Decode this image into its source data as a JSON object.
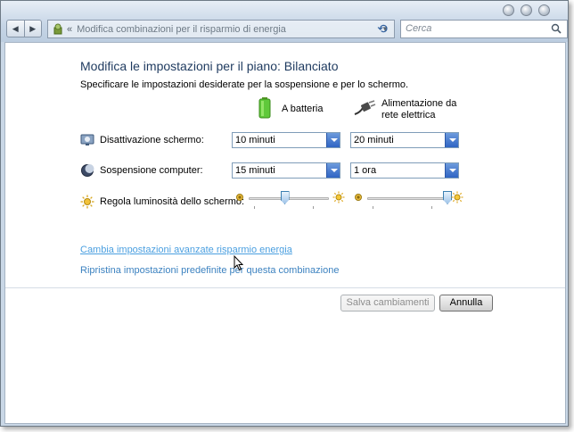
{
  "nav": {
    "back_glyph": "◀",
    "forward_glyph": "▶",
    "breadcrumb_sep": "«",
    "address_path": "Modifica combinazioni per il risparmio di energia",
    "search_placeholder": "Cerca"
  },
  "page": {
    "title": "Modifica le impostazioni per il piano: Bilanciato",
    "subtitle": "Specificare le impostazioni desiderate per la sospensione e per lo schermo.",
    "col_battery": "A batteria",
    "col_plugged_line1": "Alimentazione da",
    "col_plugged_line2": "rete elettrica"
  },
  "rows": {
    "display_off": {
      "label": "Disattivazione schermo:",
      "battery_value": "10 minuti",
      "plugged_value": "20 minuti"
    },
    "sleep": {
      "label": "Sospensione computer:",
      "battery_value": "15 minuti",
      "plugged_value": "1 ora"
    },
    "brightness": {
      "label": "Regola luminosità dello schermo:",
      "battery_level": 0.45,
      "plugged_level": 1.0
    }
  },
  "links": {
    "advanced": "Cambia impostazioni avanzate risparmio energia",
    "restore": "Ripristina impostazioni predefinite per questa combinazione"
  },
  "buttons": {
    "save": "Salva cambiamenti",
    "cancel": "Annulla"
  },
  "icons": {
    "folder": "power-options-icon",
    "refresh": "refresh-icon",
    "search": "search-icon",
    "battery": "battery-icon",
    "plug": "power-plug-icon",
    "display": "monitor-icon",
    "sleep": "moon-icon",
    "brightness": "sun-icon"
  },
  "colors": {
    "link": "#3c82c0",
    "title": "#1e3a5f",
    "combo_arrow": "#2f64c4"
  }
}
